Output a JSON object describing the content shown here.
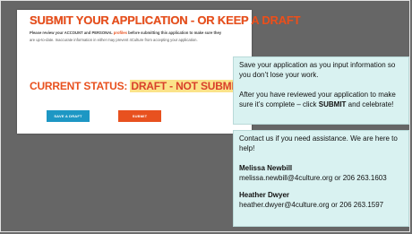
{
  "form": {
    "title": "SUBMIT YOUR APPLICATION - OR KEEP A DRAFT",
    "instr_prefix": "Please review your ",
    "instr_account": "ACCOUNT",
    "instr_and": " and ",
    "instr_personal": "PERSONAL",
    "instr_profiles": " profiles",
    "instr_rest": " before submitting this application to make sure they",
    "instr_line2": "are up-to-date. Inaccurate information in either may prevent 4Culture from accepting your application.",
    "status_label": "CURRENT STATUS: ",
    "status_value": "DRAFT - NOT SUBMITTED",
    "save_draft_label": "SAVE A DRAFT",
    "submit_label": "SUBMIT"
  },
  "note_top": {
    "para1": "Save your application as you input information so you don’t lose your work.",
    "para2_prefix": "After you have reviewed your application to make sure it’s complete – click ",
    "para2_bold": "SUBMIT",
    "para2_suffix": " and celebrate!"
  },
  "note_bottom": {
    "intro": "Contact us if you need assistance. We are here to help!",
    "contact1_name": "Melissa Newbill",
    "contact1_info": "melissa.newbill@4culture.org or 206 263.1603",
    "contact2_name": "Heather Dwyer",
    "contact2_info": "heather.dwyer@4culture.org or 206 263.1597"
  },
  "colors": {
    "accent_orange": "#e8511f",
    "draft_blue": "#1d97c4",
    "status_highlight": "#fbe38a",
    "note_background": "#d9f2f1",
    "backdrop_gray": "#666666"
  }
}
